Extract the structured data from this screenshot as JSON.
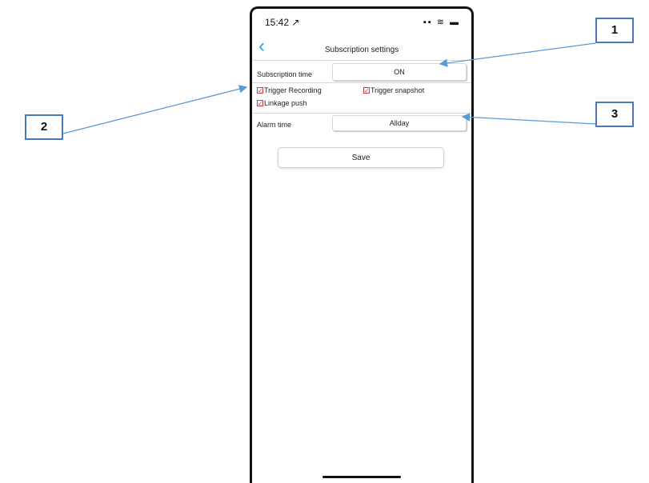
{
  "status_bar": {
    "time": "15:42 ↗",
    "icons": "▪▪ ≋ ▬"
  },
  "nav": {
    "back_icon": "chevron-left-icon",
    "title": "Subscription settings"
  },
  "subscription": {
    "label": "Subscription time",
    "value": "ON"
  },
  "checkboxes": [
    {
      "label": "Trigger Recording",
      "checked": true
    },
    {
      "label": "Trigger snapshot",
      "checked": true
    },
    {
      "label": "Linkage push",
      "checked": true
    }
  ],
  "alarm": {
    "label": "Alarm time",
    "value": "Allday"
  },
  "save_label": "Save",
  "callouts": [
    "1",
    "2",
    "3"
  ],
  "colors": {
    "accent": "#2aa7e6",
    "checkbox": "#d23a3a",
    "callout_border": "#4a78b8",
    "arrow": "#5b9bd5"
  }
}
